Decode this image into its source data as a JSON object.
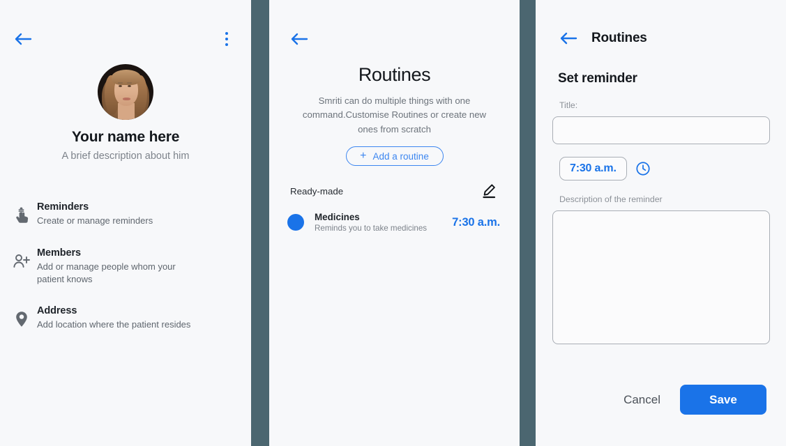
{
  "theme": {
    "accent": "#1a73e8",
    "accent_light": "#3c86f0",
    "divider": "#4b6670",
    "page_bg": "#f7f8fa",
    "text_primary": "#14181d",
    "text_secondary": "#7d838b",
    "border": "#a9aeb5"
  },
  "profile_panel": {
    "back_icon": "arrow-left-icon",
    "overflow_icon": "kebab-menu-icon",
    "avatar_alt": "user-avatar-photo",
    "name": "Your name here",
    "description": "A brief description about him",
    "menu_items": [
      {
        "icon": "finger-with-string-icon",
        "title": "Reminders",
        "subtitle": "Create or manage reminders"
      },
      {
        "icon": "person-add-icon",
        "title": "Members",
        "subtitle": "Add or manage people whom your patient knows"
      },
      {
        "icon": "map-pin-icon",
        "title": "Address",
        "subtitle": "Add location where the patient resides"
      }
    ]
  },
  "routines_panel": {
    "back_icon": "arrow-left-icon",
    "title": "Routines",
    "subtitle": "Smriti can do multiple things with one command.Customise Routines or create new ones from scratch",
    "add_button": {
      "icon": "plus-icon",
      "label": "Add a routine"
    },
    "section_label": "Ready-made",
    "edit_icon": "pencil-edit-icon",
    "routines": [
      {
        "dot_color": "#1a73e8",
        "name": "Medicines",
        "subtitle": "Reminds you to take medicines",
        "time": "7:30 a.m."
      }
    ]
  },
  "reminder_panel": {
    "back_icon": "arrow-left-icon",
    "header_title": "Routines",
    "section_title": "Set reminder",
    "title_label": "Title:",
    "title_value": "",
    "title_placeholder": "",
    "time_value": "7:30 a.m.",
    "clock_icon": "clock-icon",
    "description_label": "Description of the reminder",
    "description_value": "",
    "description_placeholder": "",
    "cancel_label": "Cancel",
    "save_label": "Save"
  }
}
